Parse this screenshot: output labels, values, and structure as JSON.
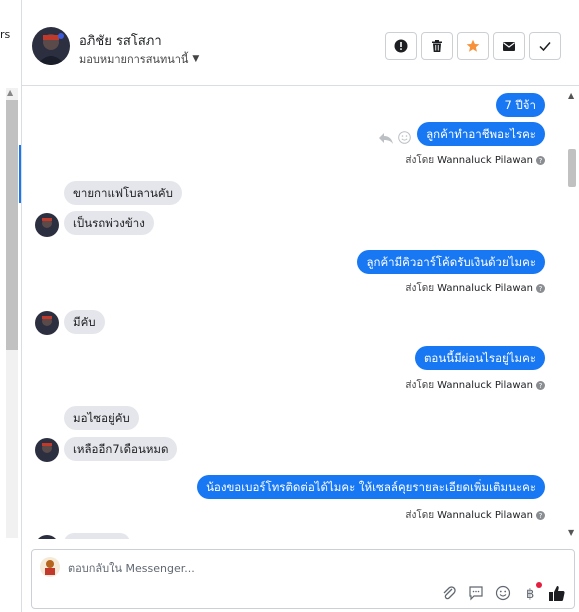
{
  "left_panel": {
    "fragment": "rs"
  },
  "header": {
    "name": "อภิชัย รสโสภา",
    "assign_label": "มอบหมายการสนทนานี้",
    "actions": [
      {
        "name": "report-button",
        "icon": "exclamation-circle-icon"
      },
      {
        "name": "delete-button",
        "icon": "trash-icon"
      },
      {
        "name": "star-button",
        "icon": "star-icon",
        "color": "#f7923b"
      },
      {
        "name": "mark-unread-button",
        "icon": "envelope-icon"
      },
      {
        "name": "mark-done-button",
        "icon": "checkmark-icon"
      }
    ]
  },
  "sent_by_prefix": "ส่งโดย",
  "messages": [
    {
      "dir": "out",
      "text": "7 ปีจ้า"
    },
    {
      "dir": "out",
      "text": "ลูกค้าทำอาชีพอะไรคะ",
      "sent_by": "Wannaluck Pilawan"
    },
    {
      "dir": "in",
      "text": "ขายกาแฟโบลานคับ"
    },
    {
      "dir": "in",
      "text": "เป็นรถพ่วงข้าง",
      "avatar": true
    },
    {
      "dir": "out",
      "text": "ลูกค้ามีคิวอาร์โค้ดรับเงินด้วยไมคะ",
      "sent_by": "Wannaluck Pilawan"
    },
    {
      "dir": "in",
      "text": "มีคับ",
      "avatar": true
    },
    {
      "dir": "out",
      "text": "ตอนนี้มีผ่อนไรอยู่ไมคะ",
      "sent_by": "Wannaluck Pilawan"
    },
    {
      "dir": "in",
      "text": "มอไซอยู่คับ"
    },
    {
      "dir": "in",
      "text": "เหลืออีก7เดือนหมด",
      "avatar": true
    },
    {
      "dir": "out",
      "text": "น้องขอเบอร์โทรติดต่อได้ไมคะ ให้เซลล์คุยรายละเอียดเพิ่มเติมนะคะ",
      "sent_by": "Wannaluck Pilawan"
    }
  ],
  "composer": {
    "placeholder": "ตอบกลับใน Messenger...",
    "value": "",
    "tools": [
      "paperclip-icon",
      "speech-bubble-icon",
      "emoji-icon",
      "baht-icon",
      "thumbs-up-icon"
    ],
    "accent": "#1877f2"
  },
  "colors": {
    "brand": "#1877f2",
    "bubble_in": "#e4e6eb",
    "star": "#f7923b"
  }
}
